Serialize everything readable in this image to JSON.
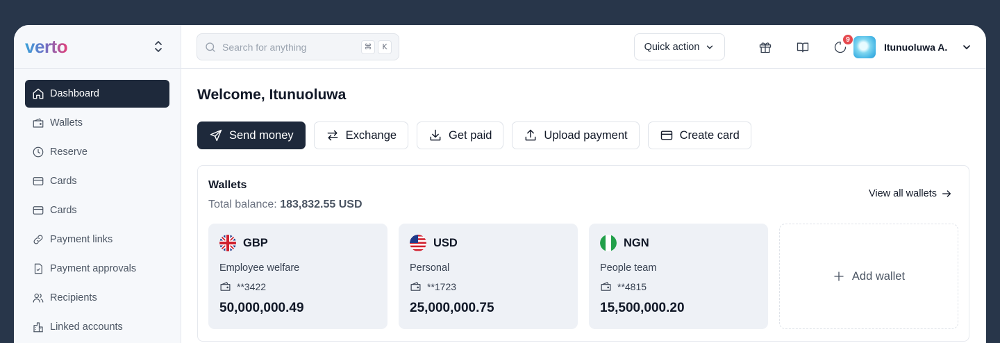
{
  "brand": {
    "logo_text": "verto"
  },
  "sidebar": {
    "items": [
      {
        "label": "Dashboard",
        "icon": "home-icon",
        "active": true
      },
      {
        "label": "Wallets",
        "icon": "wallet-icon"
      },
      {
        "label": "Reserve",
        "icon": "clock-icon"
      },
      {
        "label": "Cards",
        "icon": "card-icon"
      },
      {
        "label": "Cards",
        "icon": "card-icon"
      },
      {
        "label": "Payment links",
        "icon": "link-icon"
      },
      {
        "label": "Payment approvals",
        "icon": "file-check-icon"
      },
      {
        "label": "Recipients",
        "icon": "users-icon"
      },
      {
        "label": "Linked accounts",
        "icon": "bank-icon"
      }
    ]
  },
  "topbar": {
    "search_placeholder": "Search for anything",
    "shortcut_key1": "⌘",
    "shortcut_key2": "K",
    "quick_action_label": "Quick action",
    "notification_count": "9",
    "user_name": "Itunuoluwa A."
  },
  "main": {
    "welcome": "Welcome, Itunuoluwa",
    "actions": [
      {
        "label": "Send money",
        "icon": "send-icon",
        "primary": true
      },
      {
        "label": "Exchange",
        "icon": "exchange-icon"
      },
      {
        "label": "Get paid",
        "icon": "download-icon"
      },
      {
        "label": "Upload payment",
        "icon": "upload-icon"
      },
      {
        "label": "Create card",
        "icon": "card-icon"
      }
    ],
    "wallets_section": {
      "title": "Wallets",
      "balance_label": "Total balance:",
      "balance_value": "183,832.55 USD",
      "view_all": "View all wallets",
      "wallets": [
        {
          "currency": "GBP",
          "name": "Employee welfare",
          "account": "**3422",
          "amount": "50,000,000.49",
          "flag": "uk-flag-icon"
        },
        {
          "currency": "USD",
          "name": "Personal",
          "account": "**1723",
          "amount": "25,000,000.75",
          "flag": "us-flag-icon"
        },
        {
          "currency": "NGN",
          "name": "People team",
          "account": "**4815",
          "amount": "15,500,000.20",
          "flag": "ng-flag-icon"
        }
      ],
      "add_wallet": "Add wallet"
    }
  },
  "colors": {
    "background": "#28364a",
    "primary": "#1e293b",
    "card_bg": "#eef1f6",
    "badge": "#e5484d"
  }
}
